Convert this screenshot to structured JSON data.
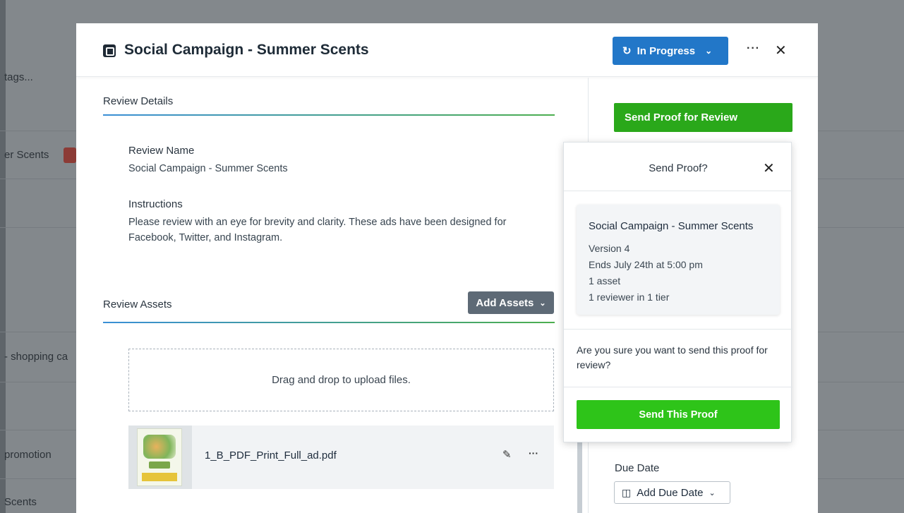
{
  "background": {
    "rows": [
      "tags...",
      "er Scents",
      "- shopping ca",
      "promotion",
      "Scents"
    ]
  },
  "modal": {
    "title": "Social Campaign - Summer Scents",
    "status_label": "In Progress",
    "more_label": "···",
    "close_label": "✕"
  },
  "review_details": {
    "heading": "Review Details",
    "name_label": "Review Name",
    "name_value": "Social Campaign - Summer Scents",
    "instructions_label": "Instructions",
    "instructions_value": "Please review with an eye for brevity and clarity. These ads have been designed for Facebook, Twitter, and Instagram."
  },
  "review_assets": {
    "heading": "Review Assets",
    "add_button": "Add Assets",
    "dropzone_text": "Drag and drop to upload files.",
    "files": [
      {
        "name": "1_B_PDF_Print_Full_ad.pdf"
      }
    ]
  },
  "sidebar": {
    "send_review_button": "Send Proof for Review",
    "due_date_label": "Due Date",
    "due_date_button": "Add Due Date"
  },
  "popover": {
    "title": "Send Proof?",
    "close_label": "✕",
    "summary": {
      "title": "Social Campaign - Summer Scents",
      "version": "Version 4",
      "ends": "Ends July 24th at 5:00 pm",
      "assets": "1 asset",
      "reviewers": "1 reviewer in 1 tier"
    },
    "confirm_text": "Are you sure you want to send this proof for review?",
    "send_button": "Send This Proof"
  },
  "colors": {
    "status_blue": "#2277c8",
    "send_green": "#2aa81a",
    "send_proof_green": "#2ec419",
    "add_assets_gray": "#5e6a76"
  }
}
